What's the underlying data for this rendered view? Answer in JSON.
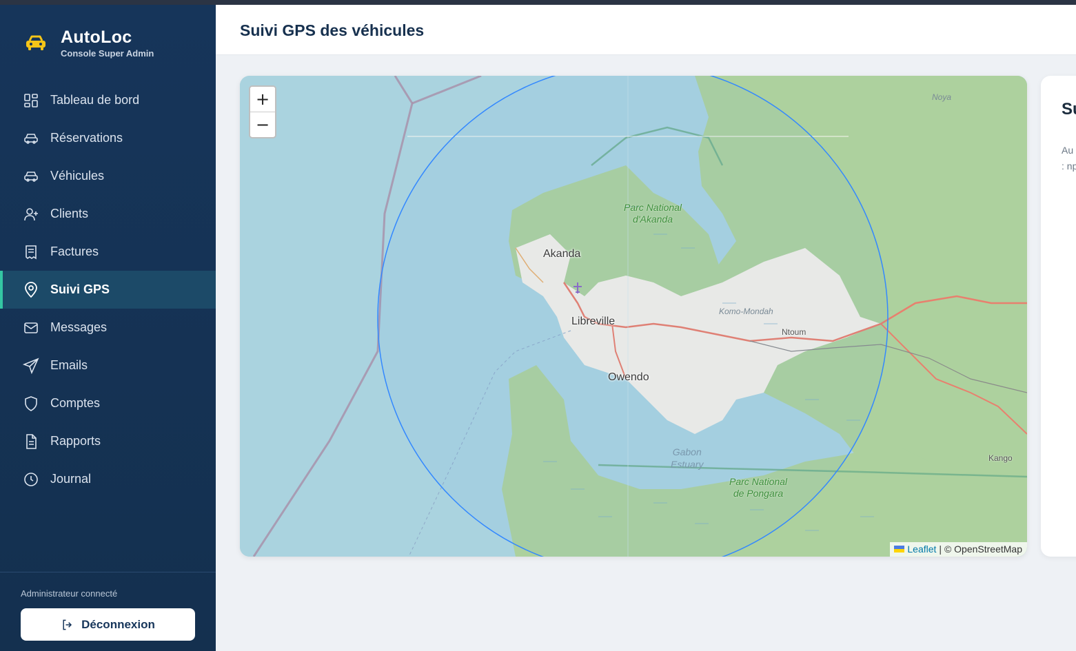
{
  "app": {
    "name": "AutoLoc",
    "subtitle": "Console Super Admin"
  },
  "sidebar": {
    "items": [
      {
        "label": "Tableau de bord",
        "icon": "dashboard-icon",
        "active": false
      },
      {
        "label": "Réservations",
        "icon": "car-icon",
        "active": false
      },
      {
        "label": "Véhicules",
        "icon": "car-icon",
        "active": false
      },
      {
        "label": "Clients",
        "icon": "user-plus-icon",
        "active": false
      },
      {
        "label": "Factures",
        "icon": "receipt-icon",
        "active": false
      },
      {
        "label": "Suivi GPS",
        "icon": "map-pin-icon",
        "active": true
      },
      {
        "label": "Messages",
        "icon": "mail-icon",
        "active": false
      },
      {
        "label": "Emails",
        "icon": "send-icon",
        "active": false
      },
      {
        "label": "Comptes",
        "icon": "shield-icon",
        "active": false
      },
      {
        "label": "Rapports",
        "icon": "file-text-icon",
        "active": false
      },
      {
        "label": "Journal",
        "icon": "clock-icon",
        "active": false
      }
    ],
    "admin_label": "Administrateur connecté",
    "logout_label": "Déconnexion"
  },
  "header": {
    "title": "Suivi GPS des véhicules"
  },
  "map": {
    "zoom_in": "+",
    "zoom_out": "−",
    "attribution_link": "Leaflet",
    "attribution_rest": "| © OpenStreetMap",
    "labels": {
      "akanda": "Akanda",
      "libreville": "Libreville",
      "owendo": "Owendo",
      "ntoum": "Ntoum",
      "kango": "Kango",
      "noya": "Noya",
      "komo_mondah": "Komo-Mondah",
      "parc_akanda_1": "Parc National",
      "parc_akanda_2": "d'Akanda",
      "gabon_estuary_1": "Gabon",
      "gabon_estuary_2": "Estuary",
      "parc_pongara_1": "Parc National",
      "parc_pongara_2": "de Pongara"
    },
    "colors": {
      "water": "#a9d3df",
      "land": "#f2efe6",
      "forest": "#add19e",
      "radius": "#3388ff",
      "road": "#e8806e"
    }
  },
  "side_panel": {
    "title": "Su",
    "text_line1": "Au",
    "text_line2": ": np"
  }
}
